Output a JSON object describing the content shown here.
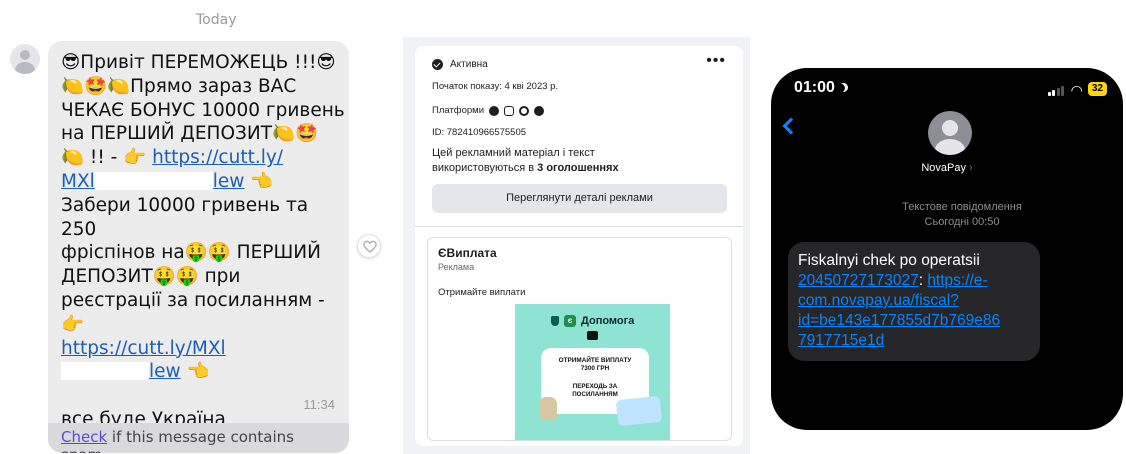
{
  "sms": {
    "date_label": "Today",
    "lines": {
      "l1": "😎Привіт ПЕРЕМОЖЕЦЬ !!!😎",
      "l2": "🍋🤩🍋Прямо зараз ВАС",
      "l3": "ЧЕКАЄ БОНУС 10000 гривень",
      "l4": "на ПЕРШИЙ ДЕПОЗИТ🍋🤩",
      "l5": "🍋 !! - 👉 ",
      "link1_a": "https://cutt.ly/",
      "link1_b": "MXl",
      "link1_c": "lew",
      "l6_tail": " 👈",
      "l7": "Забери 10000 гривень та 250",
      "l8": "фріспінов на🤑🤑 ПЕРШИЙ",
      "l9": "ДЕПОЗИТ🤑🤑 при",
      "l10": "реєстрації за посиланням -",
      "l11": "👉",
      "link2_a": "https://cutt.ly/MXl",
      "link2_b": "lew",
      "l12_tail": " 👈",
      "l13": "все буде Україна"
    },
    "time": "11:34",
    "spam_check_link": "Check",
    "spam_check_text": " if this message contains spam"
  },
  "ad": {
    "status": "Активна",
    "more_label": "•••",
    "start_line": "Початок показу: 4 кві 2023 р.",
    "platforms_label": "Платформи",
    "id_line": "ID: 782410966575505",
    "desc_a": "Цей рекламний матеріал і текст",
    "desc_b": "використовуються в ",
    "desc_bold": "3 оголошеннях",
    "details_button": "Переглянути деталі реклами",
    "advertiser": "ЄВиплата",
    "sponsored": "Реклама",
    "ad_text": "Отримайте виплати",
    "creative": {
      "brand": "Допомога",
      "headline_1": "ОТРИМАЙТЕ ВИПЛАТУ",
      "headline_2": "7300 ГРН",
      "cta_1": "ПЕРЕХОДЬ ЗА",
      "cta_2": "ПОСИЛАННЯМ"
    }
  },
  "phone": {
    "clock": "01:00",
    "battery": "32",
    "contact": "NovaPay",
    "contact_chevron": "›",
    "meta_line1": "Текстове повідомлення",
    "meta_line2": "Сьогодні 00:50",
    "msg_text": "Fiskalnyi chek po operatsii ",
    "msg_link1": "20450727173027",
    "msg_colon": ": ",
    "msg_link2_a": "https://e-",
    "msg_link2_b": "com.novapay.ua/fiscal?",
    "msg_link2_c": "id=be143e177855d7b769e86",
    "msg_link2_d": "7917715e1d"
  },
  "colors": {
    "ios_link": "#0a84ff",
    "android_link": "#1a5fb4",
    "battery": "#ffd60a",
    "creative_bg": "#8fe3d3"
  }
}
